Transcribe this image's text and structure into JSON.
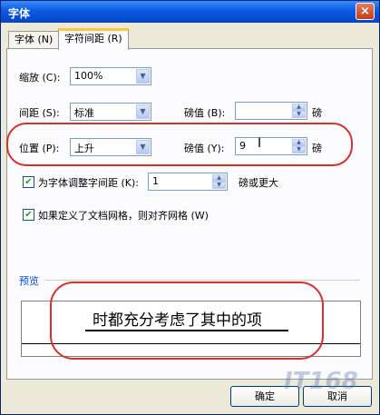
{
  "window": {
    "title": "字体",
    "close": "×"
  },
  "tabs": [
    {
      "label": "字体 (N)",
      "active": false
    },
    {
      "label": "字符间距 (R)",
      "active": true
    }
  ],
  "scale": {
    "label": "缩放 (C):",
    "value": "100%"
  },
  "spacing": {
    "label": "间距 (S):",
    "value": "标准",
    "pt_label": "磅值 (B):",
    "pt_value": "",
    "unit": "磅"
  },
  "position": {
    "label": "位置 (P):",
    "value": "上升",
    "pt_label": "磅值 (Y):",
    "pt_value": "9",
    "unit": "磅"
  },
  "kerning": {
    "label": "为字体调整字间距 (K):",
    "value": "1",
    "suffix": "磅或更大",
    "checked": true
  },
  "grid": {
    "label": "如果定义了文档网格，则对齐网格 (W)",
    "checked": true
  },
  "preview": {
    "label": "预览",
    "text": "时都充分考虑了其中的项"
  },
  "buttons": {
    "ok": "确定",
    "cancel": "取消"
  },
  "watermark": "IT168"
}
